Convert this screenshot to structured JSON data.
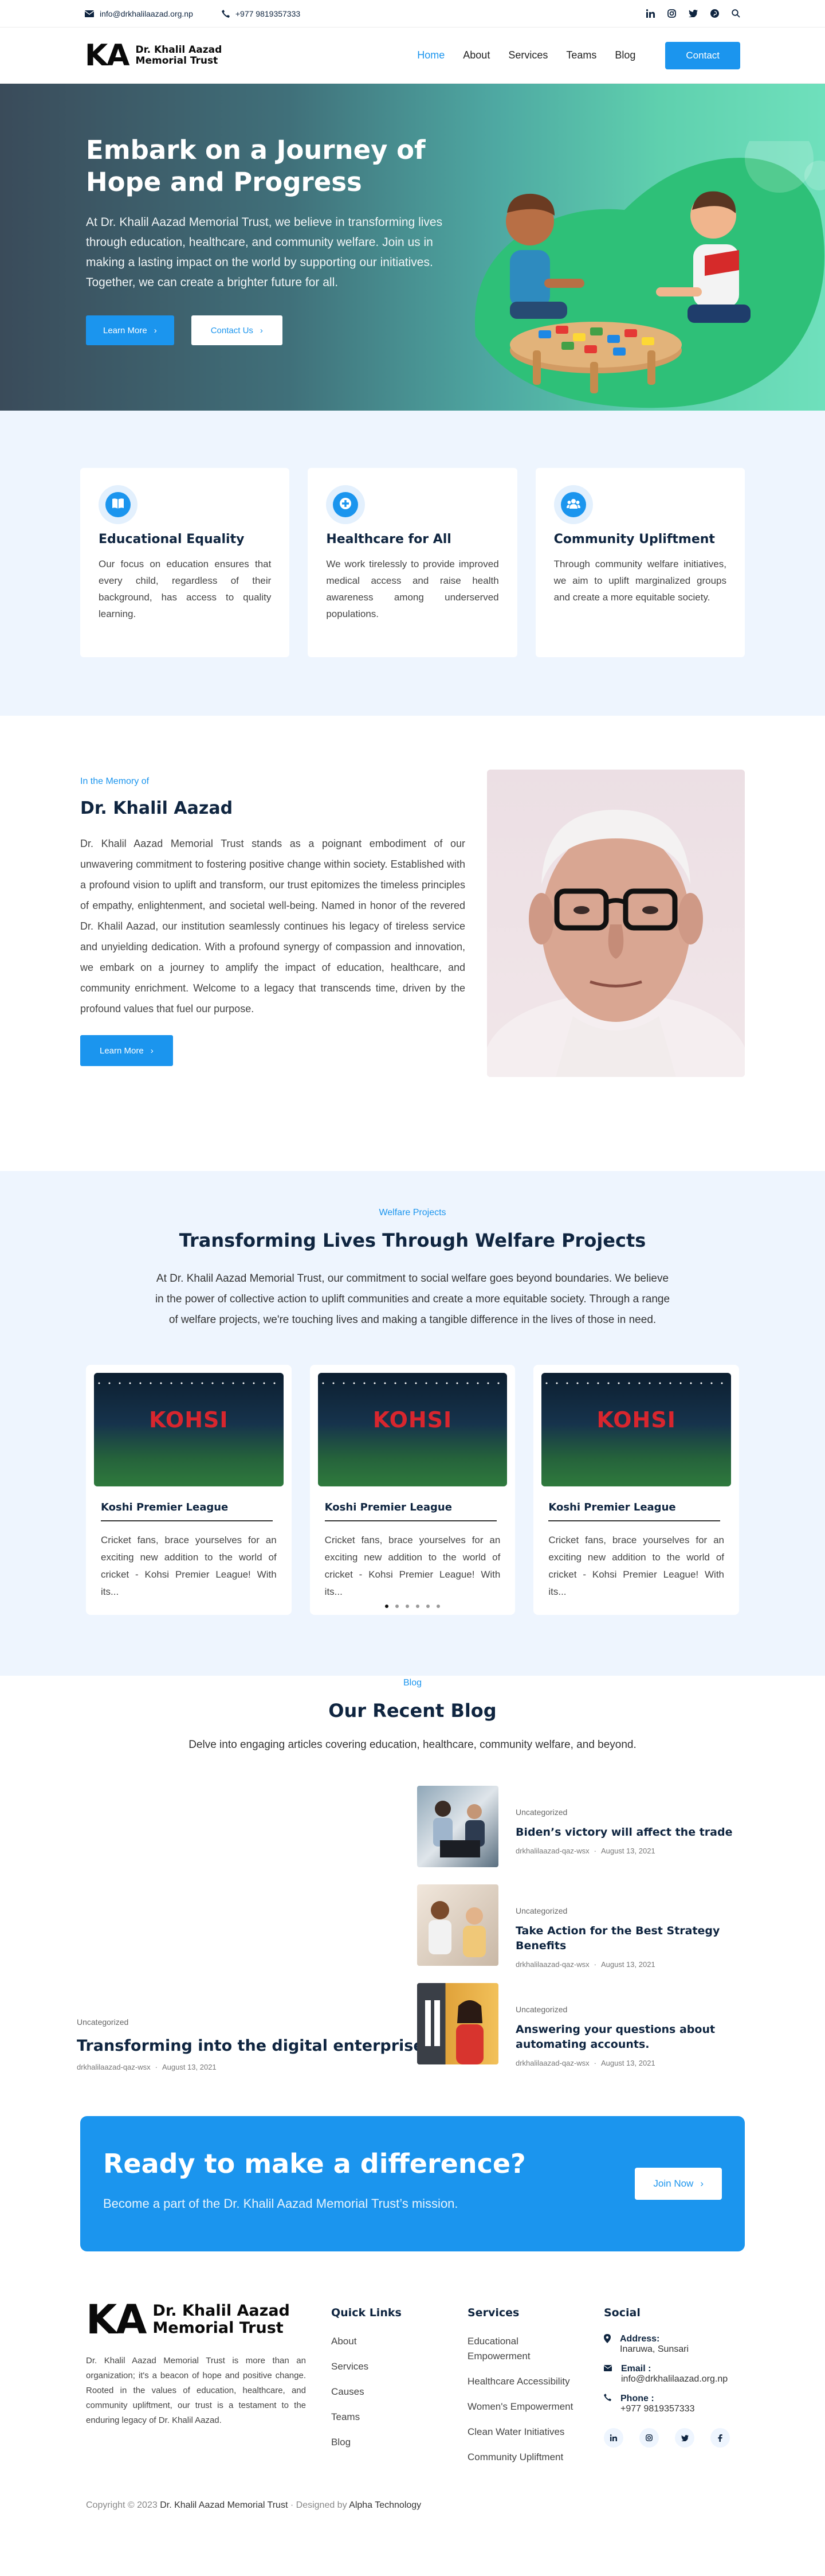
{
  "topbar": {
    "email": "info@drkhalilaazad.org.np",
    "phone": "+977 9819357333"
  },
  "brand": {
    "mark": "KA",
    "line1": "Dr. Khalil Aazad",
    "line2": "Memorial Trust"
  },
  "nav": {
    "items": [
      "Home",
      "About",
      "Services",
      "Teams",
      "Blog"
    ],
    "contact_label": "Contact"
  },
  "hero": {
    "title": "Embark on a Journey of Hope and Progress",
    "text": "At Dr. Khalil Aazad Memorial Trust, we believe in transforming lives through education, healthcare, and community welfare. Join us in making a lasting impact on the world by supporting our initiatives. Together, we can create a brighter future for all.",
    "learn_more": "Learn More",
    "contact_us": "Contact Us"
  },
  "features": [
    {
      "icon": "book-icon",
      "title": "Educational Equality",
      "text": "Our focus on education ensures that every child, regardless of their background, has access to quality learning."
    },
    {
      "icon": "plus-icon",
      "title": "Healthcare for All",
      "text": "We work tirelessly to provide improved medical access and raise health awareness among underserved populations."
    },
    {
      "icon": "users-icon",
      "title": "Community Upliftment",
      "text": "Through community welfare initiatives, we aim to uplift marginalized groups and create a more equitable society."
    }
  ],
  "memory": {
    "eyebrow": "In the Memory of",
    "title": "Dr. Khalil Aazad",
    "text": "Dr. Khalil Aazad Memorial Trust stands as a poignant embodiment of our unwavering commitment to fostering positive change within society. Established with a profound vision to uplift and transform, our trust epitomizes the timeless principles of empathy, enlightenment, and societal well-being. Named in honor of the revered Dr. Khalil Aazad, our institution seamlessly continues his legacy of tireless service and unyielding dedication. With a profound synergy of compassion and innovation, we embark on a journey to amplify the impact of education, healthcare, and community enrichment. Welcome to a legacy that transcends time, driven by the profound values that fuel our purpose.",
    "button": "Learn More"
  },
  "welfare": {
    "eyebrow": "Welfare Projects",
    "title": "Transforming Lives Through Welfare Projects",
    "intro": "At Dr. Khalil Aazad Memorial Trust, our commitment to social welfare goes beyond boundaries. We believe in the power of collective action to uplift communities and create a more equitable society. Through a range of welfare projects, we're touching lives and making a tangible difference in the lives of those in need.",
    "thumb_text": "KOHSI",
    "projects": [
      {
        "title": "Koshi Premier League",
        "text": "Cricket fans, brace yourselves for an exciting new addition to the world of cricket - Kohsi Premier League! With its..."
      },
      {
        "title": "Koshi Premier League",
        "text": "Cricket fans, brace yourselves for an exciting new addition to the world of cricket - Kohsi Premier League! With its..."
      },
      {
        "title": "Koshi Premier League",
        "text": "Cricket fans, brace yourselves for an exciting new addition to the world of cricket - Kohsi Premier League! With its..."
      }
    ],
    "carousel_active": 1,
    "carousel_count": 6
  },
  "blog": {
    "eyebrow": "Blog",
    "title": "Our Recent Blog",
    "intro": "Delve into engaging articles covering education, healthcare, community welfare, and beyond.",
    "featured": {
      "category": "Uncategorized",
      "title": "Transforming into the digital enterprise",
      "author": "drkhalilaazad-qaz-wsx",
      "date": "August 13, 2021"
    },
    "posts": [
      {
        "category": "Uncategorized",
        "title": "Biden’s victory will affect the trade",
        "author": "drkhalilaazad-qaz-wsx",
        "date": "August 13, 2021"
      },
      {
        "category": "Uncategorized",
        "title": "Take Action for the Best Strategy Benefits",
        "author": "drkhalilaazad-qaz-wsx",
        "date": "August 13, 2021"
      },
      {
        "category": "Uncategorized",
        "title": "Answering your questions about automating accounts.",
        "author": "drkhalilaazad-qaz-wsx",
        "date": "August 13, 2021"
      }
    ]
  },
  "cta": {
    "title": "Ready to make a difference?",
    "text": "Become a part of the Dr. Khalil Aazad Memorial Trust’s mission.",
    "button": "Join Now"
  },
  "footer": {
    "about": "Dr. Khalil Aazad Memorial Trust is more than an organization; it's a beacon of hope and positive change. Rooted in the values of education, healthcare, and community upliftment, our trust is a testament to the enduring legacy of Dr. Khalil Aazad.",
    "quick_links_title": "Quick Links",
    "quick_links": [
      "About",
      "Services",
      "Causes",
      "Teams",
      "Blog"
    ],
    "services_title": "Services",
    "services": [
      "Educational Empowerment",
      "Healthcare Accessibility",
      "Women's Empowerment",
      "Clean Water Initiatives",
      "Community Upliftment"
    ],
    "social_title": "Social",
    "address_label": "Address:",
    "address": "Inaruwa, Sunsari",
    "email_label": "Email :",
    "email": "info@drkhalilaazad.org.np",
    "phone_label": "Phone :",
    "phone": "+977 9819357333",
    "copyright_prefix": "Copyright © 2023",
    "copyright_name": "Dr. Khalil Aazad Memorial Trust",
    "designed_by": "· Designed by",
    "designer": "Alpha Technology"
  },
  "colors": {
    "accent": "#1b95ee",
    "navy": "#0f2540",
    "light_bg": "#eef5fe"
  }
}
